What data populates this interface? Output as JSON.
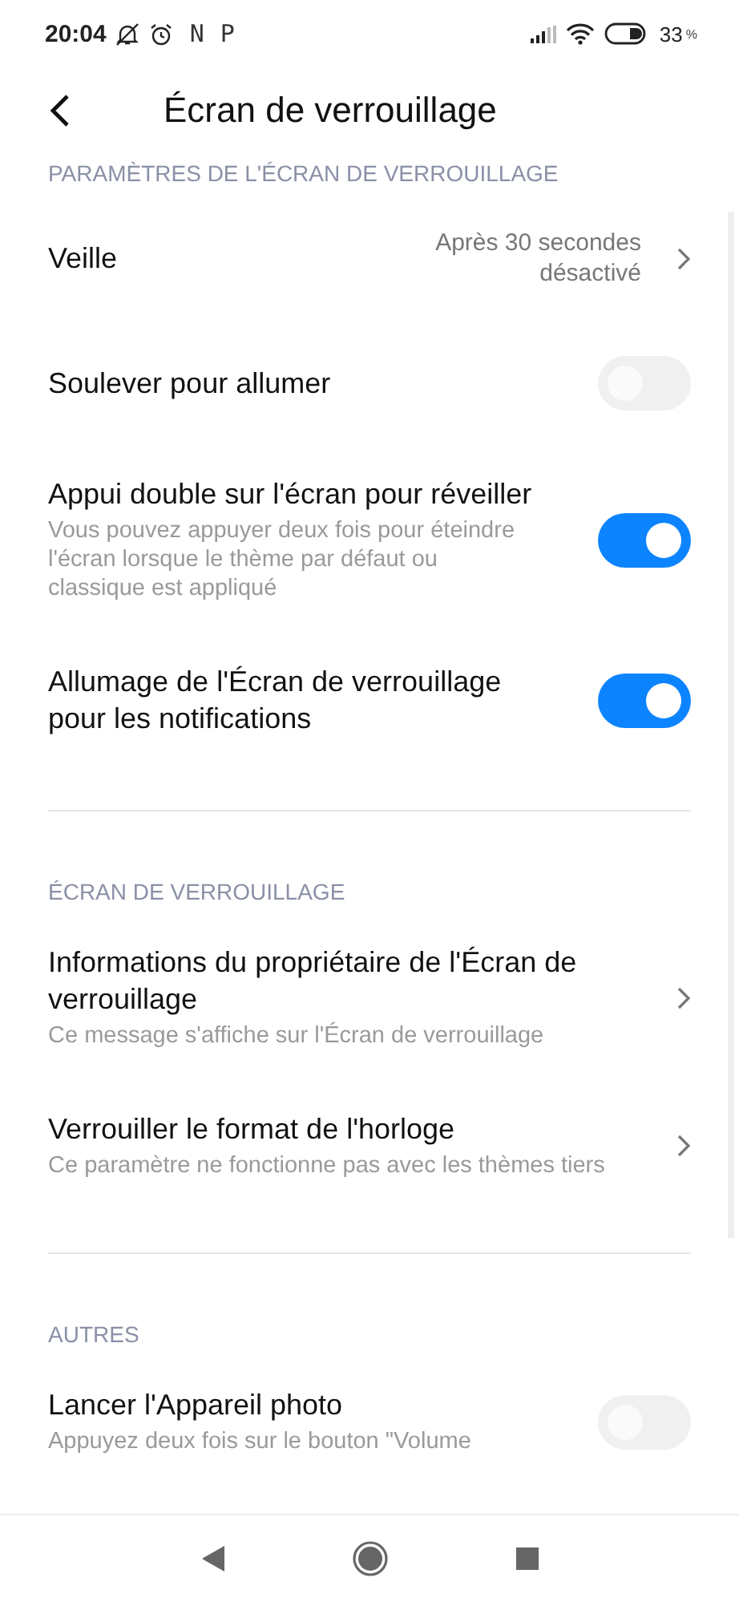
{
  "status_bar": {
    "time": "20:04",
    "notification_letters": [
      "N",
      "P"
    ],
    "battery": "33",
    "battery_unit": "%"
  },
  "header": {
    "title": "Écran de verrouillage"
  },
  "sections": [
    {
      "title": "PARAMÈTRES DE L'ÉCRAN DE VERROUILLAGE",
      "items": [
        {
          "kind": "value",
          "title": "Veille",
          "value": "Après 30 secondes désactivé"
        },
        {
          "kind": "toggle",
          "title": "Soulever pour allumer",
          "on": false
        },
        {
          "kind": "toggle",
          "title": "Appui double sur l'écran pour réveiller",
          "description": "Vous pouvez appuyer deux fois pour éteindre l'écran lorsque le thème par défaut ou classique est appliqué",
          "on": true
        },
        {
          "kind": "toggle",
          "title": "Allumage de l'Écran de verrouillage pour les notifications",
          "on": true
        }
      ]
    },
    {
      "title": "ÉCRAN DE VERROUILLAGE",
      "items": [
        {
          "kind": "link",
          "title": "Informations du propriétaire de l'Écran de verrouillage",
          "description": "Ce message s'affiche sur l'Écran de verrouillage"
        },
        {
          "kind": "link",
          "title": "Verrouiller le format de l'horloge",
          "description": "Ce paramètre ne fonctionne pas avec les thèmes tiers"
        }
      ]
    },
    {
      "title": "AUTRES",
      "items": [
        {
          "kind": "toggle",
          "title": "Lancer l'Appareil photo",
          "description": "Appuyez deux fois sur le bouton \"Volume",
          "on": false
        }
      ]
    }
  ]
}
